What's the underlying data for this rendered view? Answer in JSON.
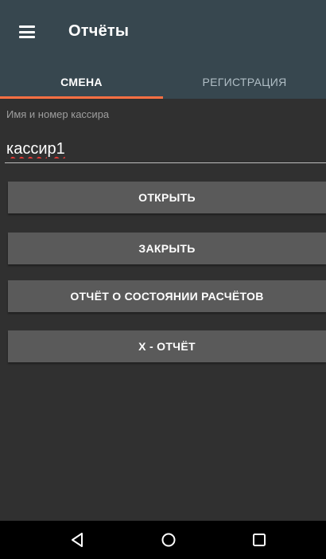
{
  "appbar": {
    "title": "Отчёты",
    "menu_icon": "menu-icon"
  },
  "tabs": [
    {
      "label": "СМЕНА",
      "active": true
    },
    {
      "label": "РЕГИСТРАЦИЯ",
      "active": false
    }
  ],
  "cashier": {
    "label": "Имя и номер кассира",
    "value": "кассир1"
  },
  "buttons": {
    "open": "ОТКРЫТЬ",
    "close": "ЗАКРЫТЬ",
    "settlement_report": "ОТЧЁТ О СОСТОЯНИИ РАСЧЁТОВ",
    "x_report": "X - ОТЧЁТ"
  },
  "navbar": {
    "icons": [
      "back-icon",
      "home-icon",
      "recents-icon"
    ]
  },
  "colors": {
    "appbar": "#37474f",
    "background": "#303030",
    "tab_indicator": "#ff7043",
    "button": "#5a5a5a"
  }
}
